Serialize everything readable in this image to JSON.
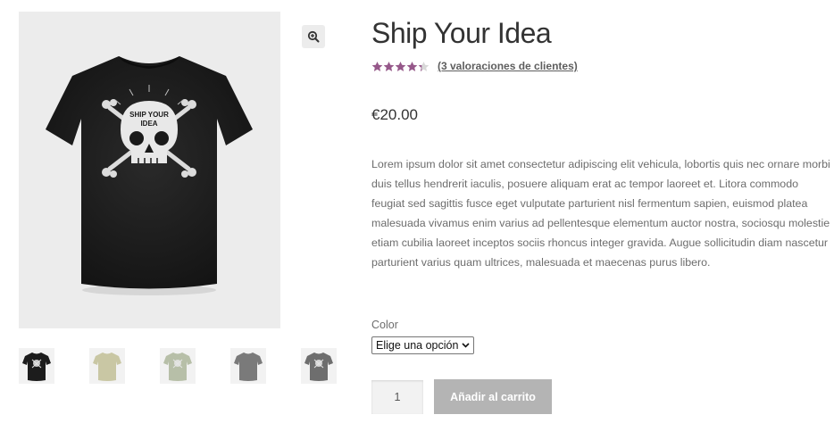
{
  "product": {
    "title": "Ship Your Idea",
    "rating": 4.33,
    "rating_max": 5,
    "review_link": "(3 valoraciones de clientes)",
    "price": "€20.00",
    "description": "Lorem ipsum dolor sit amet consectetur adipiscing elit vehicula, lobortis quis nec ornare morbi duis tellus hendrerit iaculis, posuere aliquam erat ac tempor laoreet et. Litora commodo feugiat sed sagittis fusce eget vulputate parturient nisl fermentum sapien, euismod platea malesuada vivamus enim varius ad pellentesque elementum auctor nostra, sociosqu molestie etiam cubilia laoreet inceptos sociis rhoncus integer gravida. Augue sollicitudin diam nascetur parturient varius quam ultrices, malesuada et maecenas purus libero.",
    "graphic_text": "SHIP YOUR IDEA"
  },
  "variation": {
    "label": "Color",
    "selected": "Elige una opción"
  },
  "cart": {
    "quantity": "1",
    "add_label": "Añadir al carrito"
  },
  "gallery": {
    "zoom_icon": "zoom-in-icon",
    "thumbnails": [
      {
        "name": "black-tshirt",
        "color": "#1c1c1c",
        "graphic": true
      },
      {
        "name": "khaki-tshirt",
        "color": "#c9c7a4",
        "graphic": false
      },
      {
        "name": "sage-tshirt",
        "color": "#b7bfa8",
        "graphic": true
      },
      {
        "name": "grey-tshirt",
        "color": "#7a7a7a",
        "graphic": false
      },
      {
        "name": "grey-tshirt-2",
        "color": "#6e6e6e",
        "graphic": true
      }
    ]
  },
  "colors": {
    "star": "#96588a",
    "button": "#b1b1b1",
    "title": "#333333"
  }
}
